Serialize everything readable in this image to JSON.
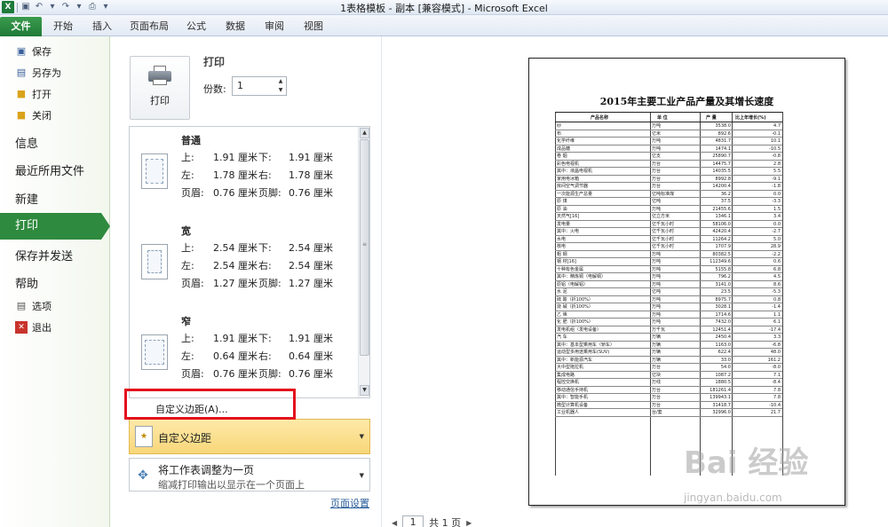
{
  "window": {
    "title": "1表格模板 - 副本  [兼容模式] - Microsoft Excel",
    "app_icon": "X"
  },
  "ribbon": {
    "tabs": [
      "文件",
      "开始",
      "插入",
      "页面布局",
      "公式",
      "数据",
      "审阅",
      "视图"
    ]
  },
  "nav": {
    "items_top": [
      {
        "label": "保存",
        "icon": "save-icon"
      },
      {
        "label": "另存为",
        "icon": "save-as-icon"
      },
      {
        "label": "打开",
        "icon": "open-folder-icon"
      },
      {
        "label": "关闭",
        "icon": "close-folder-icon"
      }
    ],
    "info": "信息",
    "recent": "最近所用文件",
    "new": "新建",
    "print": "打印",
    "save_send": "保存并发送",
    "help": "帮助",
    "options": "选项",
    "exit": "退出"
  },
  "print_panel": {
    "print_button": "打印",
    "section_title": "打印",
    "copies_label": "份数:",
    "copies_value": "1",
    "margins": [
      {
        "name": "普通",
        "top_label": "上:",
        "top": "1.91 厘米",
        "bottom_label": "下:",
        "bottom": "1.91 厘米",
        "left_label": "左:",
        "left": "1.78 厘米",
        "right_label": "右:",
        "right": "1.78 厘米",
        "header_label": "页眉:",
        "header": "0.76 厘米",
        "footer_label": "页脚:",
        "footer": "0.76 厘米"
      },
      {
        "name": "宽",
        "top_label": "上:",
        "top": "2.54 厘米",
        "bottom_label": "下:",
        "bottom": "2.54 厘米",
        "left_label": "左:",
        "left": "2.54 厘米",
        "right_label": "右:",
        "right": "2.54 厘米",
        "header_label": "页眉:",
        "header": "1.27 厘米",
        "footer_label": "页脚:",
        "footer": "1.27 厘米"
      },
      {
        "name": "窄",
        "top_label": "上:",
        "top": "1.91 厘米",
        "bottom_label": "下:",
        "bottom": "1.91 厘米",
        "left_label": "左:",
        "left": "0.64 厘米",
        "right_label": "右:",
        "right": "0.64 厘米",
        "header_label": "页眉:",
        "header": "0.76 厘米",
        "footer_label": "页脚:",
        "footer": "0.76 厘米"
      }
    ],
    "custom_margins_item": "自定义边距(A)...",
    "selected_dropdown": "自定义边距",
    "scaling_title": "将工作表调整为一页",
    "scaling_desc": "缩减打印输出以显示在一个页面上",
    "page_setup_link": "页面设置"
  },
  "preview": {
    "sheet_title": "2015年主要工业产品产量及其增长速度",
    "headers": [
      "产品名称",
      "单 位",
      "产 量",
      "比上年增长(%)"
    ],
    "rows": [
      [
        "纱",
        "万吨",
        "3538.0",
        "4.7"
      ],
      [
        "布",
        "亿米",
        "892.6",
        "-0.1"
      ],
      [
        "化学纤维",
        "万吨",
        "4831.7",
        "10.1"
      ],
      [
        "成品糖",
        "万吨",
        "1474.1",
        "-10.5"
      ],
      [
        "卷 烟",
        "亿支",
        "25890.7",
        "-0.8"
      ],
      [
        "彩色电视机",
        "万台",
        "14475.7",
        "2.8"
      ],
      [
        "  其中：液晶电视机",
        "万台",
        "14035.5",
        "5.5"
      ],
      [
        "家用电冰箱",
        "万台",
        "8992.8",
        "-9.1"
      ],
      [
        "房间空气调节器",
        "万台",
        "14200.4",
        "-1.8"
      ],
      [
        "一次能源生产总量",
        "亿吨标准煤",
        "36.2",
        "0.0"
      ],
      [
        "原 煤",
        "亿吨",
        "37.5",
        "-3.3"
      ],
      [
        "原 油",
        "万吨",
        "21455.6",
        "1.5"
      ],
      [
        "天然气[16]",
        "亿立方米",
        "1346.1",
        "3.4"
      ],
      [
        "发电量",
        "亿千瓦小时",
        "58106.0",
        "0.0"
      ],
      [
        "  其中：火电",
        "亿千瓦小时",
        "42420.4",
        "-2.7"
      ],
      [
        "        水电",
        "亿千瓦小时",
        "11264.2",
        "5.0"
      ],
      [
        "        核电",
        "亿千瓦小时",
        "1707.9",
        "28.9"
      ],
      [
        "粗 钢",
        "万吨",
        "80382.5",
        "-2.2"
      ],
      [
        "钢 材[16]",
        "万吨",
        "112349.6",
        "0.6"
      ],
      [
        "十种有色金属",
        "万吨",
        "5155.8",
        "6.8"
      ],
      [
        "  其中：精炼铜（电解铜）",
        "万吨",
        "796.2",
        "4.5"
      ],
      [
        "原铝（电解铝）",
        "万吨",
        "3141.0",
        "8.6"
      ],
      [
        "水 泥",
        "亿吨",
        "23.5",
        "-5.3"
      ],
      [
        "硫 酸（折100%）",
        "万吨",
        "8975.7",
        "0.8"
      ],
      [
        "烧 碱（折100%）",
        "万吨",
        "3028.1",
        "-1.4"
      ],
      [
        "乙 烯",
        "万吨",
        "1714.6",
        "1.1"
      ],
      [
        "化 肥（折100%）",
        "万吨",
        "7432.0",
        "6.1"
      ],
      [
        "发电机组（发电设备）",
        "万千瓦",
        "12451.4",
        "-17.4"
      ],
      [
        "汽 车",
        "万辆",
        "2450.4",
        "3.3"
      ],
      [
        "其中：基本型乘用车（轿车）",
        "万辆",
        "1163.0",
        "-6.8"
      ],
      [
        "  运动型多用途乘用车(SUV)",
        "万辆",
        "622.4",
        "48.0"
      ],
      [
        "其中：新能源汽车",
        "万辆",
        "33.0",
        "161.2"
      ],
      [
        "大中型拖拉机",
        "万台",
        "54.0",
        "-8.0"
      ],
      [
        "集成电路",
        "亿块",
        "1087.2",
        "7.1"
      ],
      [
        "程控交换机",
        "万线",
        "1880.5",
        "-8.4"
      ],
      [
        "移动通信手持机",
        "万台",
        "181261.4",
        "7.8"
      ],
      [
        "  其中：智能手机",
        "万台",
        "139943.1",
        "7.8"
      ],
      [
        "微型计算机设备",
        "万台",
        "31418.7",
        "-10.4"
      ],
      [
        "工业机器人",
        "台/套",
        "32996.0",
        "21.7"
      ]
    ],
    "page_current": "1",
    "page_total": "共 1 页"
  },
  "watermark": {
    "brand": "Bai 经验",
    "url": "jingyan.baidu.com"
  }
}
